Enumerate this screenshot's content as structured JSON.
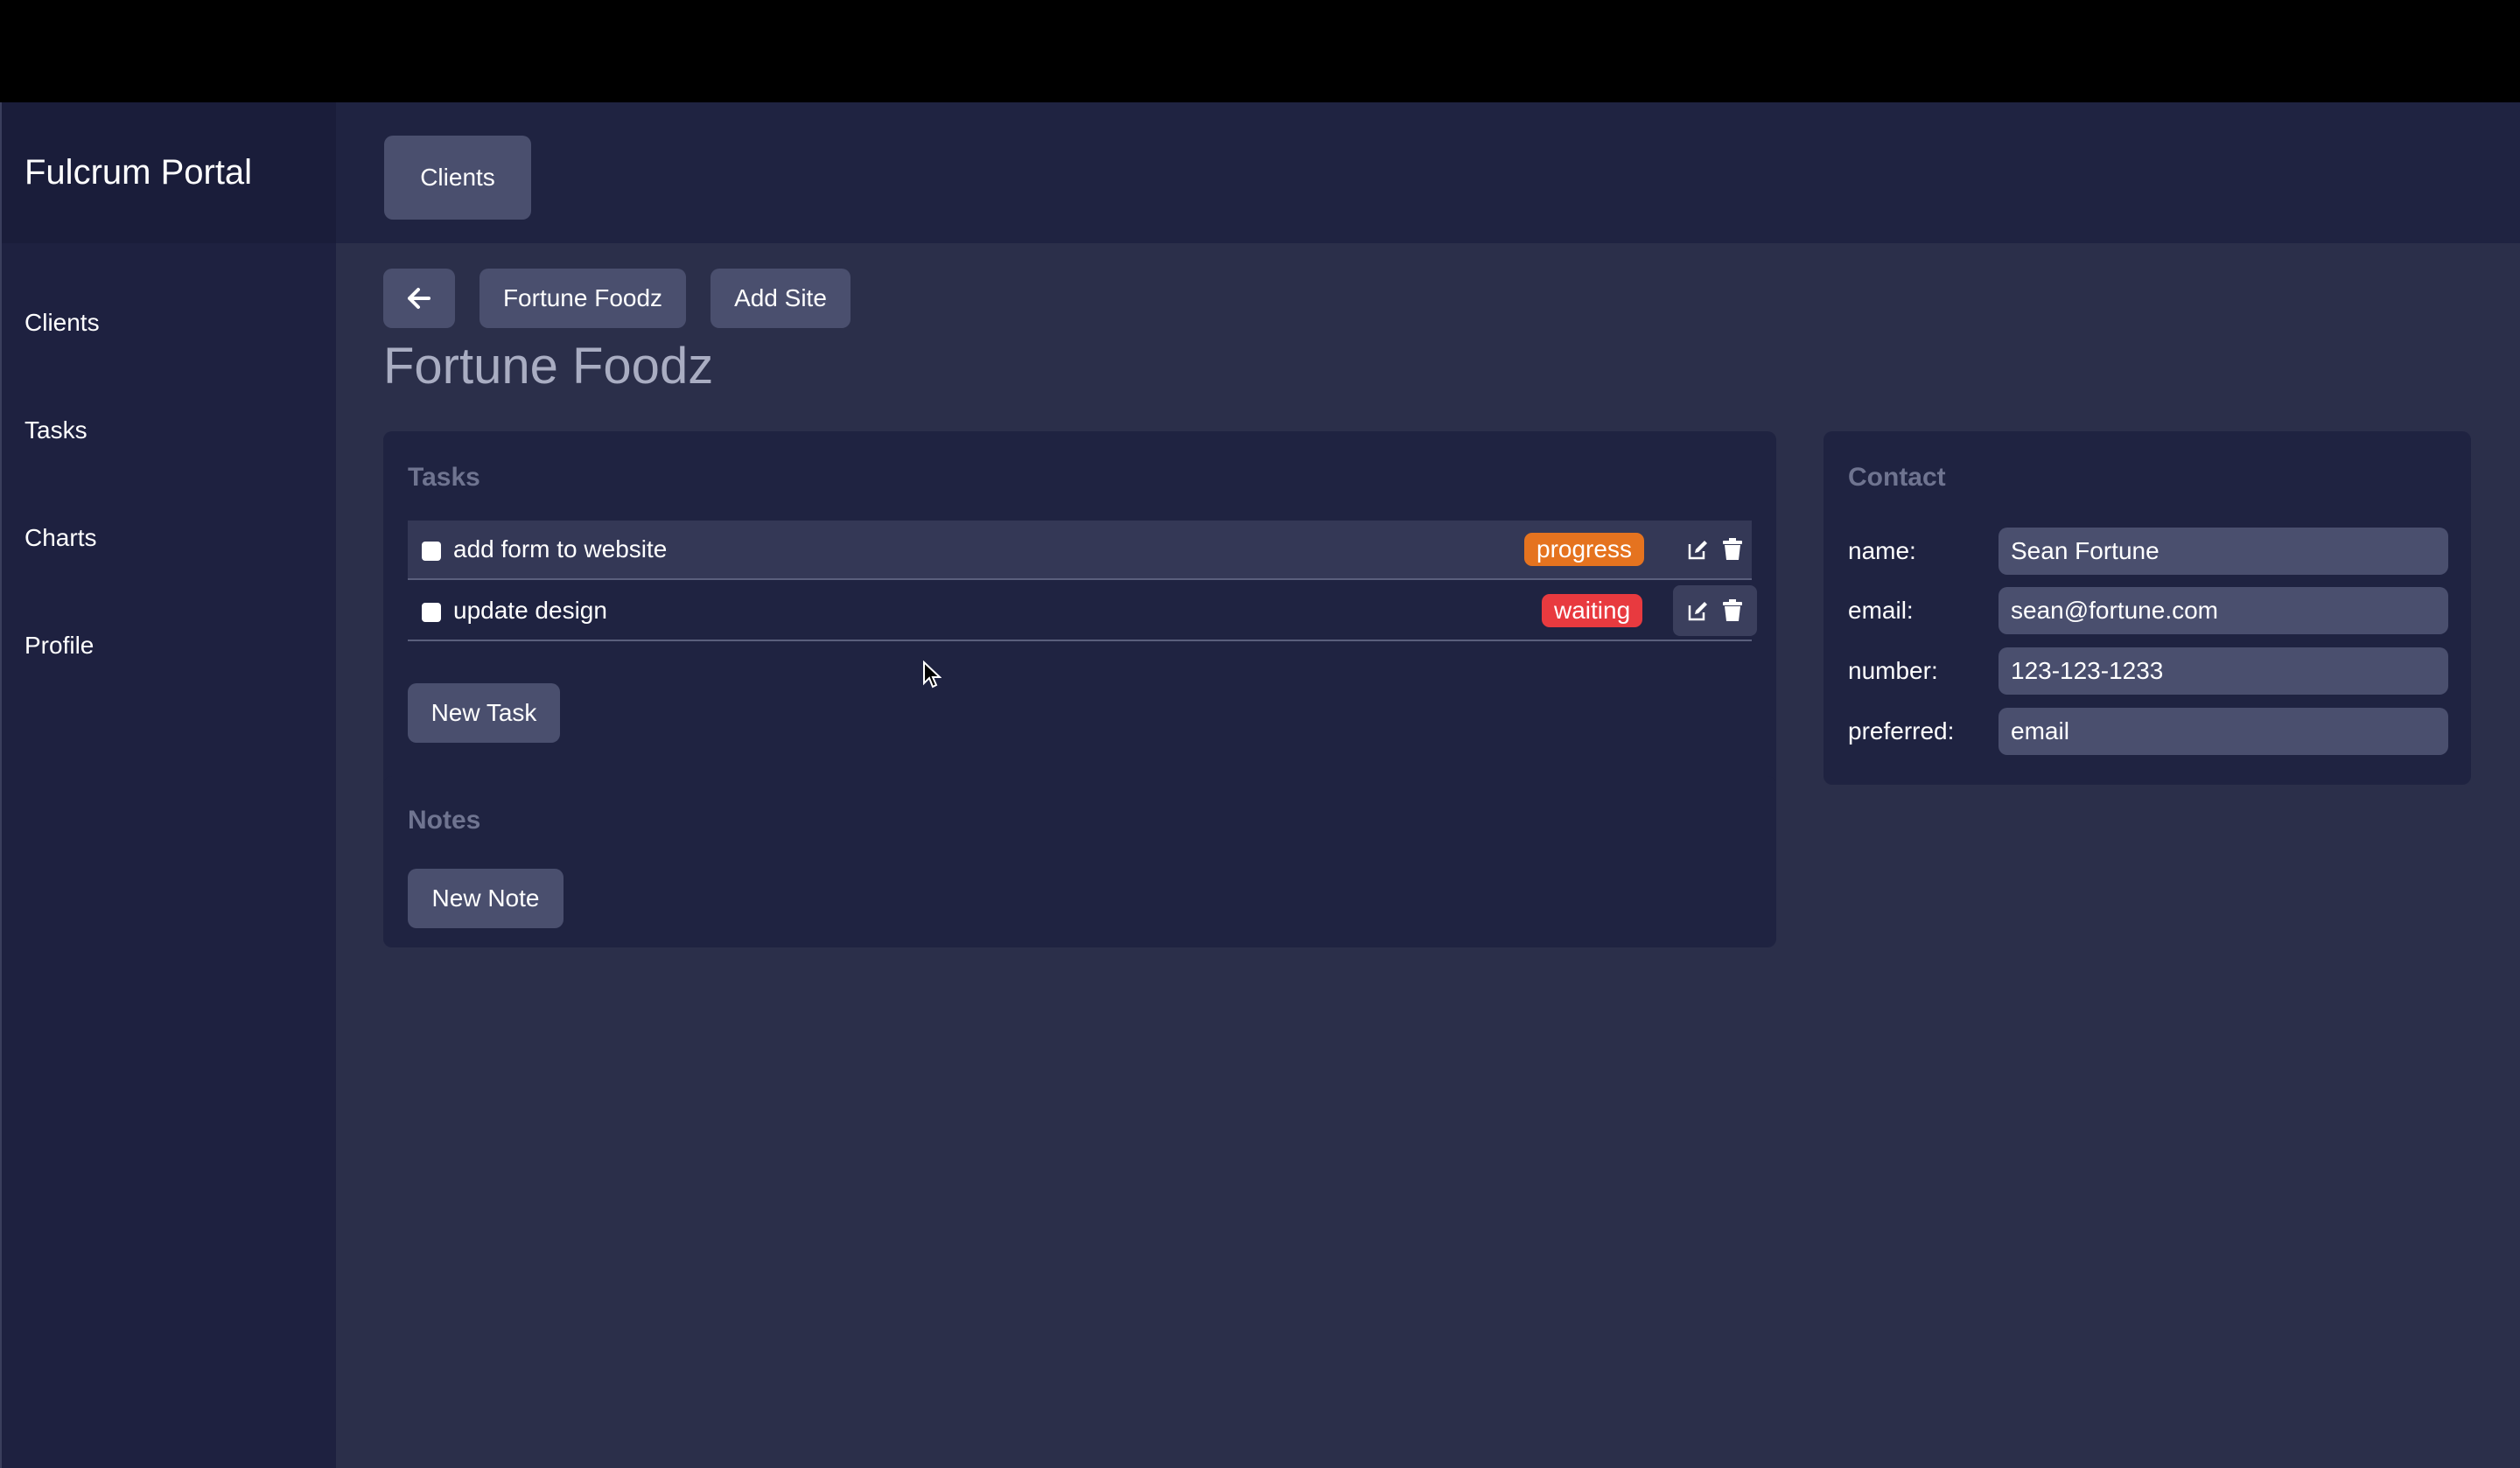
{
  "brand": "Fulcrum Portal",
  "sidebar": {
    "items": [
      {
        "label": "Clients"
      },
      {
        "label": "Tasks"
      },
      {
        "label": "Charts"
      },
      {
        "label": "Profile"
      }
    ]
  },
  "header": {
    "clients_button": "Clients"
  },
  "toolbar": {
    "back_icon": "arrow-left-icon",
    "client_button": "Fortune Foodz",
    "add_site_button": "Add Site"
  },
  "page_title": "Fortune Foodz",
  "tasks": {
    "title": "Tasks",
    "items": [
      {
        "label": "add form to website",
        "status": "progress",
        "status_color": "#e5731f"
      },
      {
        "label": "update design",
        "status": "waiting",
        "status_color": "#e83a3f"
      }
    ],
    "new_button": "New Task"
  },
  "notes": {
    "title": "Notes",
    "new_button": "New Note"
  },
  "contact": {
    "title": "Contact",
    "fields": [
      {
        "label": "name:",
        "value": "Sean Fortune"
      },
      {
        "label": "email:",
        "value": "sean@fortune.com"
      },
      {
        "label": "number:",
        "value": "123-123-1233"
      },
      {
        "label": "preferred:",
        "value": "email"
      }
    ]
  }
}
